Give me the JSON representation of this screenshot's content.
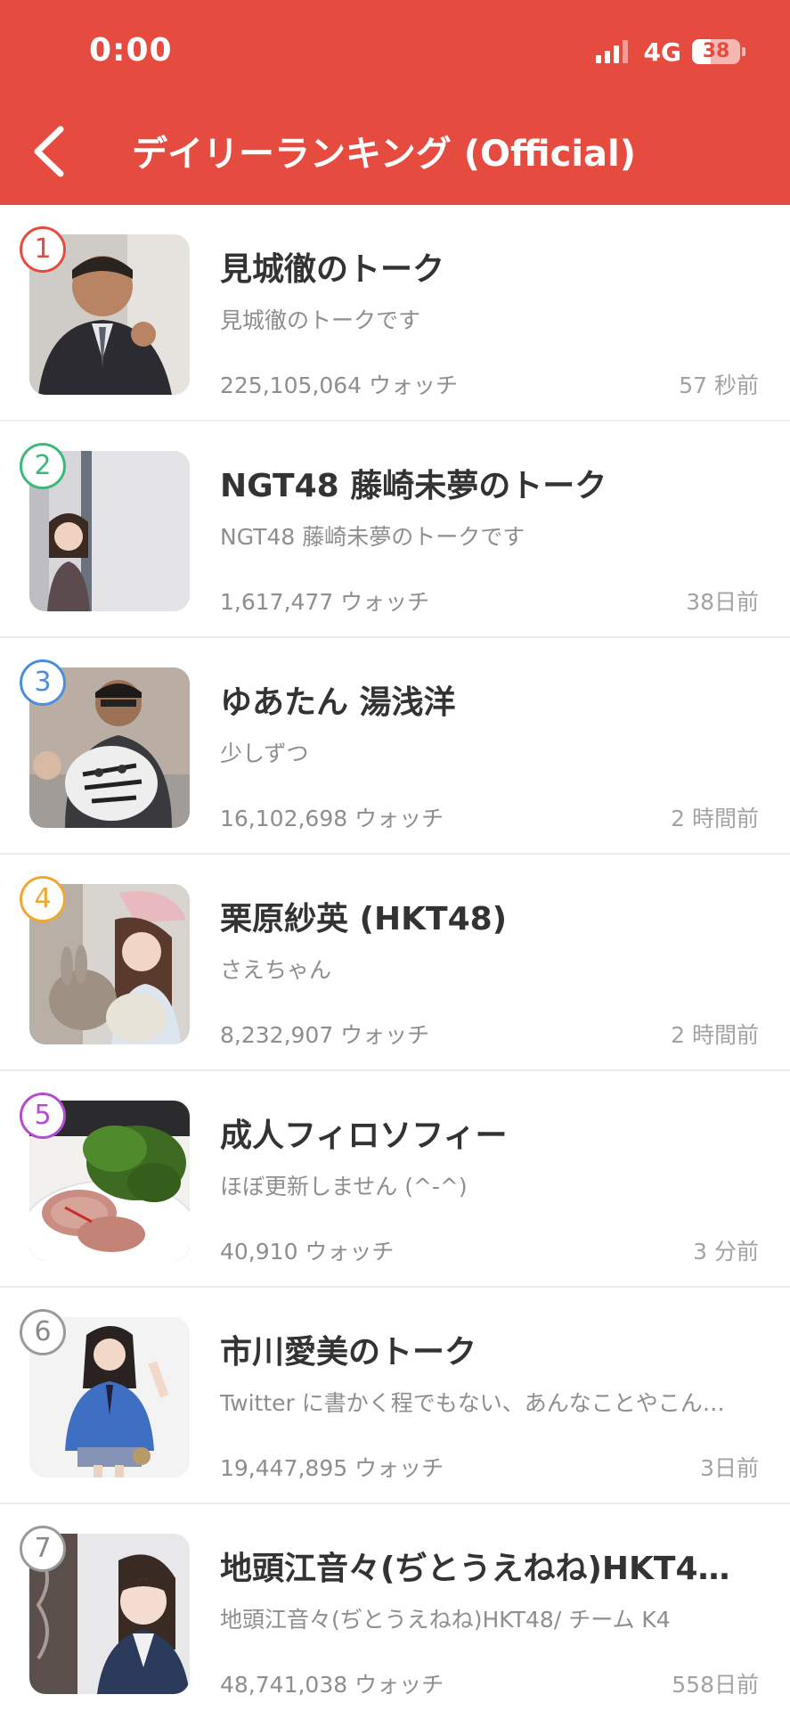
{
  "status_bar": {
    "time": "0:00",
    "network": "4G",
    "battery": "38",
    "battery_level": 0.38
  },
  "header": {
    "title": "デイリーランキング (Official)",
    "back_icon": "chevron-left-icon"
  },
  "colors": {
    "header_bg": "#E54B3F",
    "rank_1": "#E54B3F",
    "rank_2": "#3DB87A",
    "rank_3": "#4A8FDB",
    "rank_4": "#F0A830",
    "rank_5": "#B44BD1",
    "rank_other": "#9A9A9A"
  },
  "items": [
    {
      "rank": "1",
      "title": "見城徹のトーク",
      "description": "見城徹のトークです",
      "watch": "225,105,064 ウォッチ",
      "time": "57 秒前"
    },
    {
      "rank": "2",
      "title": "NGT48 藤崎未夢のトーク",
      "description": "NGT48 藤崎未夢のトークです",
      "watch": "1,617,477 ウォッチ",
      "time": "38日前"
    },
    {
      "rank": "3",
      "title": "ゆあたん 湯浅洋",
      "description": "少しずつ",
      "watch": "16,102,698 ウォッチ",
      "time": "2 時間前"
    },
    {
      "rank": "4",
      "title": "栗原紗英 (HKT48)",
      "description": "さえちゃん",
      "watch": "8,232,907 ウォッチ",
      "time": "2 時間前"
    },
    {
      "rank": "5",
      "title": "成人フィロソフィー",
      "description": "ほぼ更新しません (^-^)",
      "watch": "40,910 ウォッチ",
      "time": "3 分前"
    },
    {
      "rank": "6",
      "title": "市川愛美のトーク",
      "description": "Twitter に書かく程でもない、あんなことやこん…",
      "watch": "19,447,895 ウォッチ",
      "time": "3日前"
    },
    {
      "rank": "7",
      "title": "地頭江音々(ぢとうえねね)HKT4…",
      "description": "地頭江音々(ぢとうえねね)HKT48/ チーム K4",
      "watch": "48,741,038 ウォッチ",
      "time": "558日前"
    }
  ]
}
